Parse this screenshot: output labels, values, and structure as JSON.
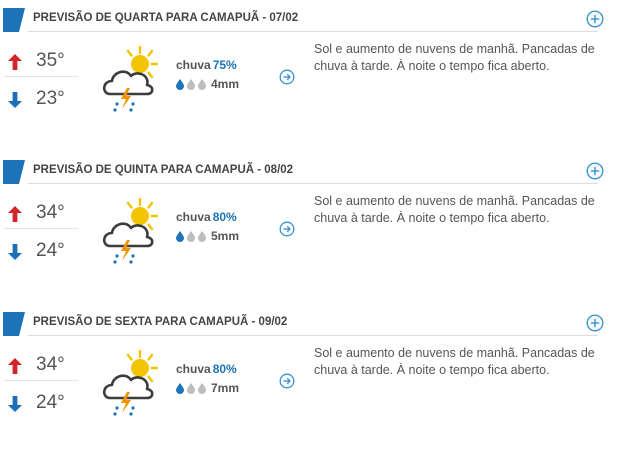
{
  "colors": {
    "accent_blue": "#1d73b8",
    "arrow_up_red": "#d0262b",
    "arrow_down_blue": "#1d6fb8",
    "sun_yellow": "#f5c400",
    "cloud_dark": "#3d3d3d",
    "bolt_orange": "#f29200",
    "rain_drop_blue": "#1d73b8",
    "drop_gray": "#bdbdbd"
  },
  "forecasts": [
    {
      "title": "PREVISÃO DE QUARTA PARA CAMAPUÃ - 07/02",
      "max": "35°",
      "min": "23°",
      "rain_label": "chuva",
      "rain_pct": "75%",
      "rain_level": 1,
      "rain_mm": "4mm",
      "description": "Sol e aumento de nuvens de manhã. Pancadas de chuva à tarde. À noite o tempo fica aberto.",
      "icon": "sun-cloud-thunderstorm-icon"
    },
    {
      "title": "PREVISÃO DE QUINTA PARA CAMAPUÃ - 08/02",
      "max": "34°",
      "min": "24°",
      "rain_label": "chuva",
      "rain_pct": "80%",
      "rain_level": 1,
      "rain_mm": "5mm",
      "description": "Sol e aumento de nuvens de manhã. Pancadas de chuva à tarde. À noite o tempo fica aberto.",
      "icon": "sun-cloud-thunderstorm-icon"
    },
    {
      "title": "PREVISÃO DE SEXTA PARA CAMAPUÃ - 09/02",
      "max": "34°",
      "min": "24°",
      "rain_label": "chuva",
      "rain_pct": "80%",
      "rain_level": 1,
      "rain_mm": "7mm",
      "description": "Sol e aumento de nuvens de manhã. Pancadas de chuva à tarde. À noite o tempo fica aberto.",
      "icon": "sun-cloud-thunderstorm-icon"
    }
  ]
}
